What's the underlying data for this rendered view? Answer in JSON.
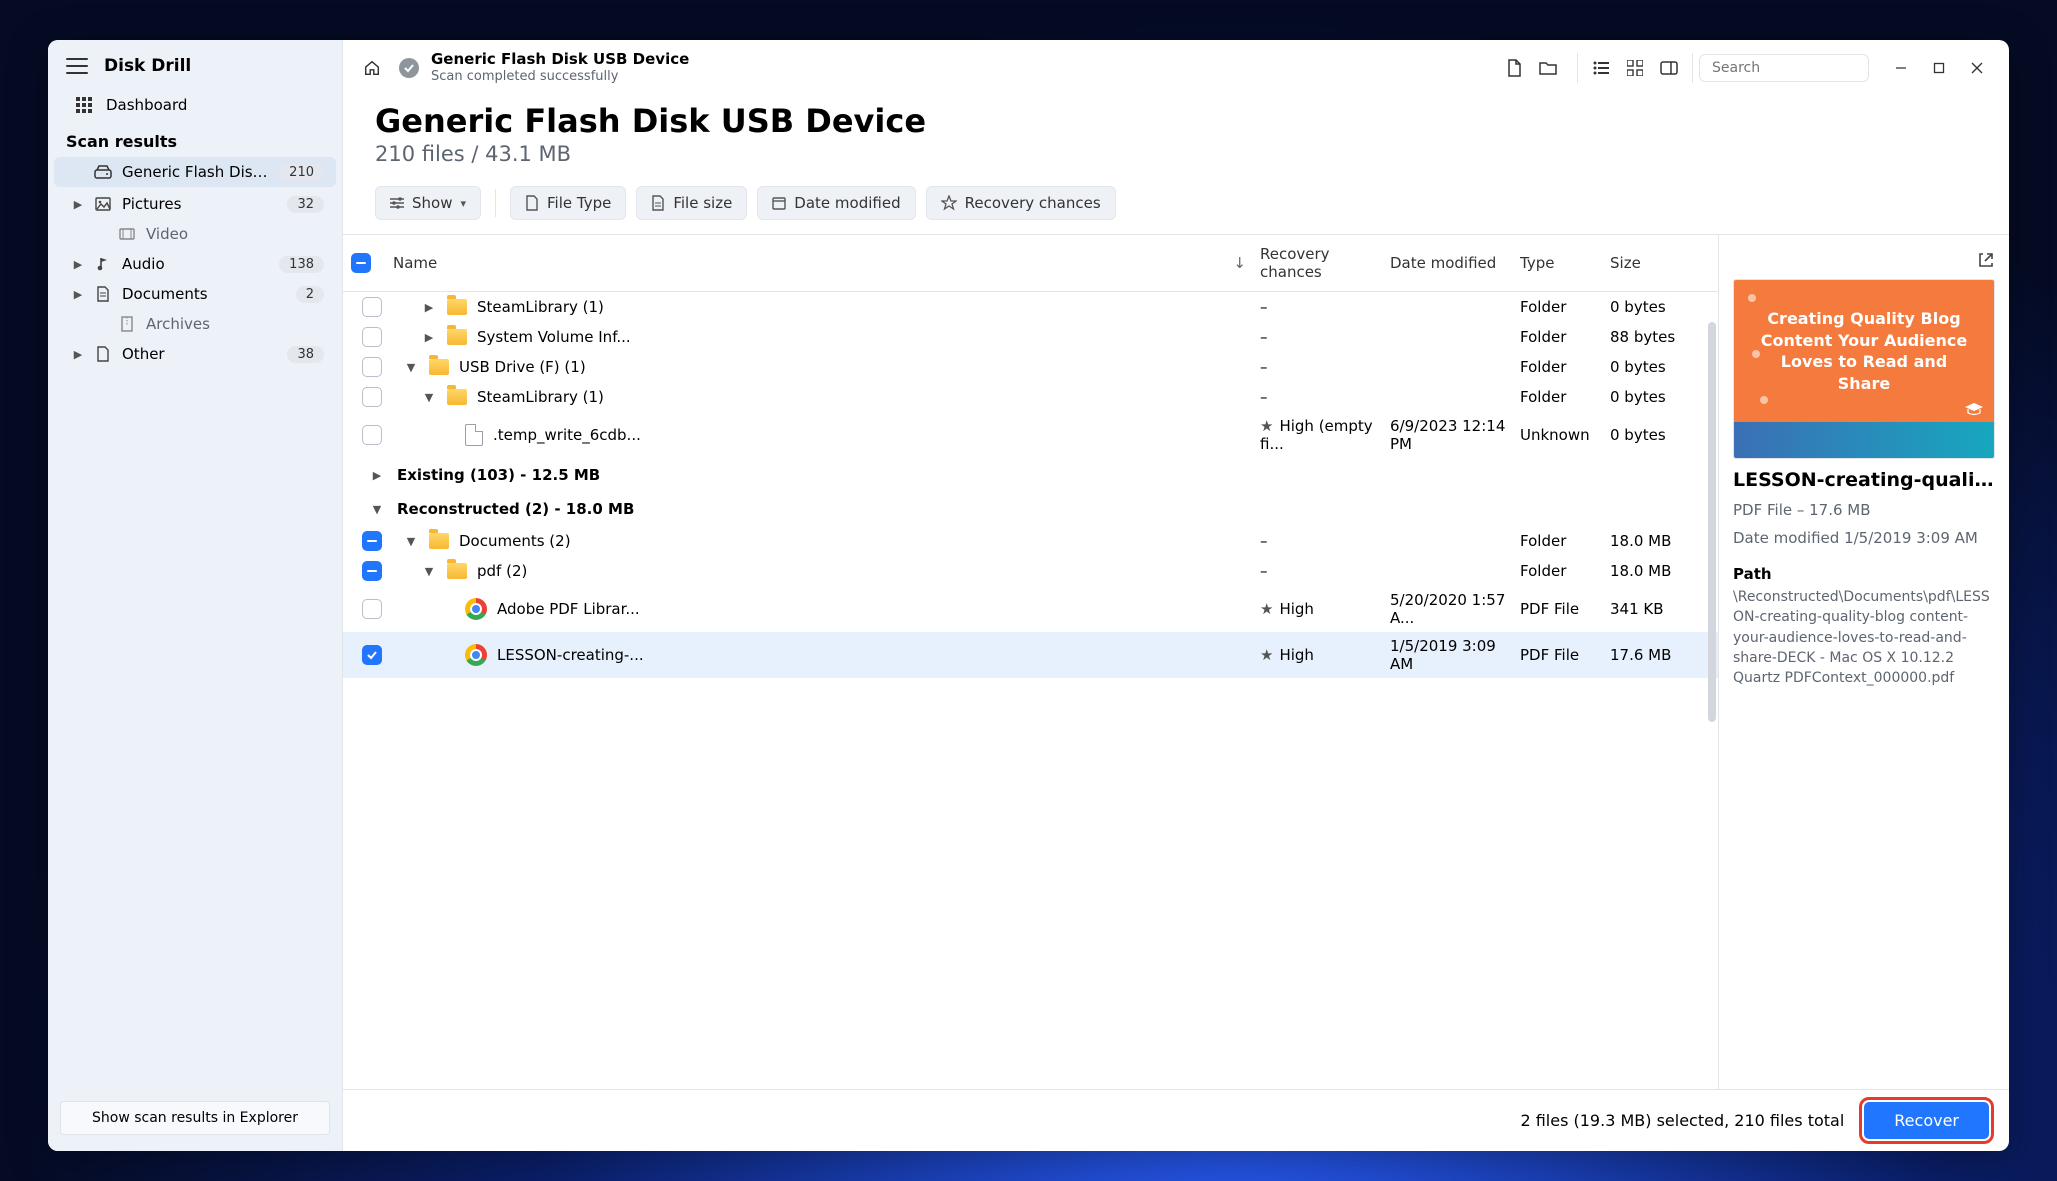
{
  "app_name": "Disk Drill",
  "sidebar": {
    "dashboard": "Dashboard",
    "section_title": "Scan results",
    "device": {
      "label": "Generic Flash Disk USB...",
      "count": "210"
    },
    "categories": [
      {
        "label": "Pictures",
        "count": "32",
        "icon": "image",
        "expandable": true
      },
      {
        "label": "Video",
        "count": "",
        "icon": "video",
        "expandable": false,
        "muted": true,
        "indent": true
      },
      {
        "label": "Audio",
        "count": "138",
        "icon": "audio",
        "expandable": true
      },
      {
        "label": "Documents",
        "count": "2",
        "icon": "doc",
        "expandable": true
      },
      {
        "label": "Archives",
        "count": "",
        "icon": "archive",
        "expandable": false,
        "muted": true,
        "indent": true
      },
      {
        "label": "Other",
        "count": "38",
        "icon": "other",
        "expandable": true
      }
    ],
    "footer_button": "Show scan results in Explorer"
  },
  "topbar": {
    "title": "Generic Flash Disk USB Device",
    "subtitle": "Scan completed successfully",
    "search_placeholder": "Search"
  },
  "header": {
    "title": "Generic Flash Disk USB Device",
    "subtitle": "210 files / 43.1 MB"
  },
  "filters": {
    "show": "Show",
    "file_type": "File Type",
    "file_size": "File size",
    "date_modified": "Date modified",
    "recovery_chances": "Recovery chances"
  },
  "columns": {
    "name": "Name",
    "recovery": "Recovery chances",
    "date": "Date modified",
    "type": "Type",
    "size": "Size"
  },
  "rows": [
    {
      "check": "empty",
      "depth": 1,
      "chev": "right",
      "icon": "folder",
      "name": "SteamLibrary (1)",
      "recovery": "–",
      "date": "",
      "type": "Folder",
      "size": "0 bytes"
    },
    {
      "check": "empty",
      "depth": 1,
      "chev": "right",
      "icon": "folder",
      "name": "System Volume Inf...",
      "recovery": "–",
      "date": "",
      "type": "Folder",
      "size": "88 bytes"
    },
    {
      "check": "empty",
      "depth": 0,
      "chev": "down",
      "icon": "folder",
      "name": "USB Drive (F) (1)",
      "recovery": "–",
      "date": "",
      "type": "Folder",
      "size": "0 bytes"
    },
    {
      "check": "empty",
      "depth": 1,
      "chev": "down",
      "icon": "folder",
      "name": "SteamLibrary (1)",
      "recovery": "–",
      "date": "",
      "type": "Folder",
      "size": "0 bytes"
    },
    {
      "check": "empty",
      "depth": 2,
      "chev": "",
      "icon": "file",
      "name": ".temp_write_6cdb...",
      "recovery": "High (empty fi...",
      "recovery_star": true,
      "date": "6/9/2023 12:14 PM",
      "type": "Unknown",
      "size": "0 bytes"
    }
  ],
  "groups": [
    {
      "chev": "right",
      "label": "Existing (103) - 12.5 MB"
    },
    {
      "chev": "down",
      "label": "Reconstructed (2) - 18.0 MB"
    }
  ],
  "rows2": [
    {
      "check": "partial",
      "depth": 0,
      "chev": "down",
      "icon": "folder",
      "name": "Documents (2)",
      "recovery": "–",
      "date": "",
      "type": "Folder",
      "size": "18.0 MB"
    },
    {
      "check": "partial",
      "depth": 1,
      "chev": "down",
      "icon": "folder",
      "name": "pdf (2)",
      "recovery": "–",
      "date": "",
      "type": "Folder",
      "size": "18.0 MB"
    },
    {
      "check": "empty",
      "depth": 2,
      "chev": "",
      "icon": "chrome",
      "name": "Adobe PDF Librar...",
      "recovery": "High",
      "recovery_star": true,
      "date": "5/20/2020 1:57 A...",
      "type": "PDF File",
      "size": "341 KB"
    },
    {
      "check": "checked",
      "depth": 2,
      "chev": "",
      "icon": "chrome",
      "name": "LESSON-creating-...",
      "recovery": "High",
      "recovery_star": true,
      "date": "1/5/2019 3:09 AM",
      "type": "PDF File",
      "size": "17.6 MB",
      "selected": true
    }
  ],
  "preview": {
    "thumb_text": "Creating Quality Blog Content Your Audience Loves to Read and Share",
    "name": "LESSON-creating-quality...",
    "meta_type": "PDF File – 17.6 MB",
    "meta_date": "Date modified 1/5/2019 3:09 AM",
    "path_label": "Path",
    "path_value": "\\Reconstructed\\Documents\\pdf\\LESSON-creating-quality-blog content-your-audience-loves-to-read-and-share-DECK - Mac OS X 10.12.2 Quartz PDFContext_000000.pdf"
  },
  "footer": {
    "status": "2 files (19.3 MB) selected, 210 files total",
    "recover": "Recover"
  }
}
